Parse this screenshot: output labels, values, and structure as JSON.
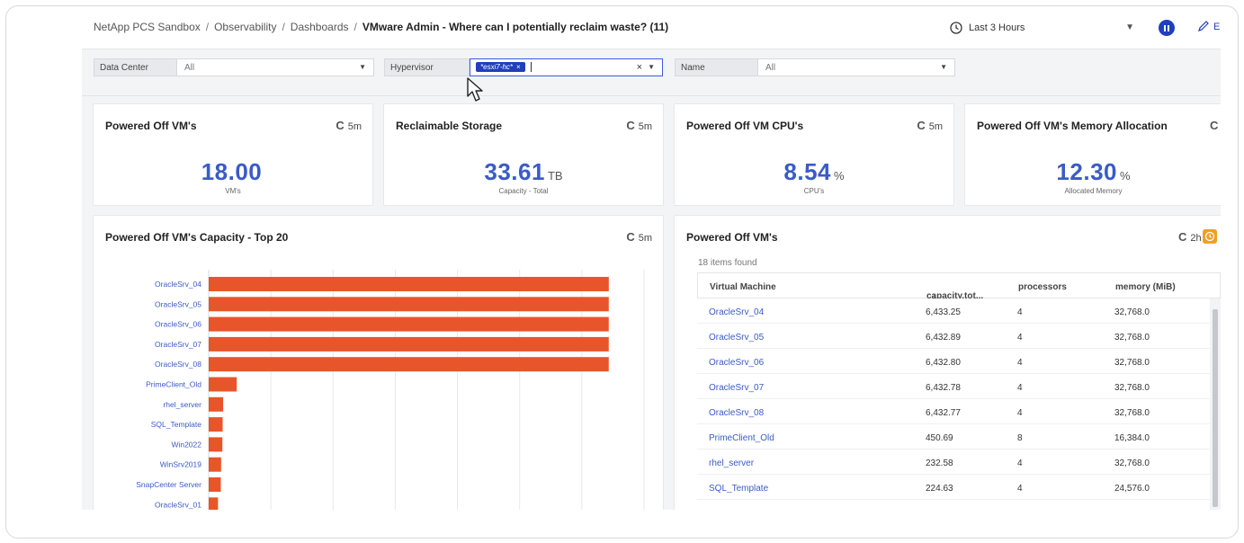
{
  "header": {
    "breadcrumb": [
      "NetApp PCS Sandbox",
      "Observability",
      "Dashboards"
    ],
    "separator": "/",
    "title": "VMware Admin - Where can I potentially reclaim waste? (11)",
    "time_range": "Last 3 Hours",
    "edit_label": "E"
  },
  "filters": [
    {
      "label": "Data Center",
      "value": "All"
    },
    {
      "label": "Hypervisor",
      "chip": "*esxi7-hc*",
      "chip_remove": "×",
      "clear": "×"
    },
    {
      "label": "Name",
      "value": "All"
    }
  ],
  "dropdown_caret": "▼",
  "refresh_icon": "C",
  "kpis": [
    {
      "title": "Powered Off VM's",
      "refresh": "5m",
      "value": "18.00",
      "unit": "",
      "sub": "VM's"
    },
    {
      "title": "Reclaimable Storage",
      "refresh": "5m",
      "value": "33.61",
      "unit": "TB",
      "sub": "Capacity - Total"
    },
    {
      "title": "Powered Off VM CPU's",
      "refresh": "5m",
      "value": "8.54",
      "unit": "%",
      "sub": "CPU's"
    },
    {
      "title": "Powered Off VM's Memory Allocation",
      "refresh": "",
      "value": "12.30",
      "unit": "%",
      "sub": "Allocated Memory"
    }
  ],
  "chart_card": {
    "title": "Powered Off VM's Capacity - Top 20",
    "refresh": "5m"
  },
  "chart_data": {
    "type": "bar",
    "orientation": "horizontal",
    "title": "Powered Off VM's Capacity - Top 20",
    "categories": [
      "OracleSrv_04",
      "OracleSrv_05",
      "OracleSrv_06",
      "OracleSrv_07",
      "OracleSrv_08",
      "PrimeClient_Old",
      "rhel_server",
      "SQL_Template",
      "Win2022",
      "WinSrv2019",
      "SnapCenter Server",
      "OracleSrv_01"
    ],
    "values": [
      6433.25,
      6432.89,
      6432.8,
      6432.78,
      6432.77,
      450.69,
      232.58,
      224.63,
      220,
      200,
      195,
      150
    ],
    "xlim": [
      0,
      7000
    ],
    "grid": true,
    "bar_color": "#e8552a"
  },
  "table_card": {
    "title": "Powered Off VM's",
    "refresh": "2h",
    "items_found": "18 items found",
    "columns": [
      "Virtual Machine",
      "capacity.tot...",
      "processors",
      "memory (MiB)"
    ],
    "sort_icon": "↓",
    "rows": [
      [
        "OracleSrv_04",
        "6,433.25",
        "4",
        "32,768.0"
      ],
      [
        "OracleSrv_05",
        "6,432.89",
        "4",
        "32,768.0"
      ],
      [
        "OracleSrv_06",
        "6,432.80",
        "4",
        "32,768.0"
      ],
      [
        "OracleSrv_07",
        "6,432.78",
        "4",
        "32,768.0"
      ],
      [
        "OracleSrv_08",
        "6,432.77",
        "4",
        "32,768.0"
      ],
      [
        "PrimeClient_Old",
        "450.69",
        "8",
        "16,384.0"
      ],
      [
        "rhel_server",
        "232.58",
        "4",
        "32,768.0"
      ],
      [
        "SQL_Template",
        "224.63",
        "4",
        "24,576.0"
      ]
    ]
  },
  "colors": {
    "accent": "#1f3fbf",
    "link": "#3a5bc7",
    "bar": "#e8552a",
    "warning": "#f0a020"
  }
}
